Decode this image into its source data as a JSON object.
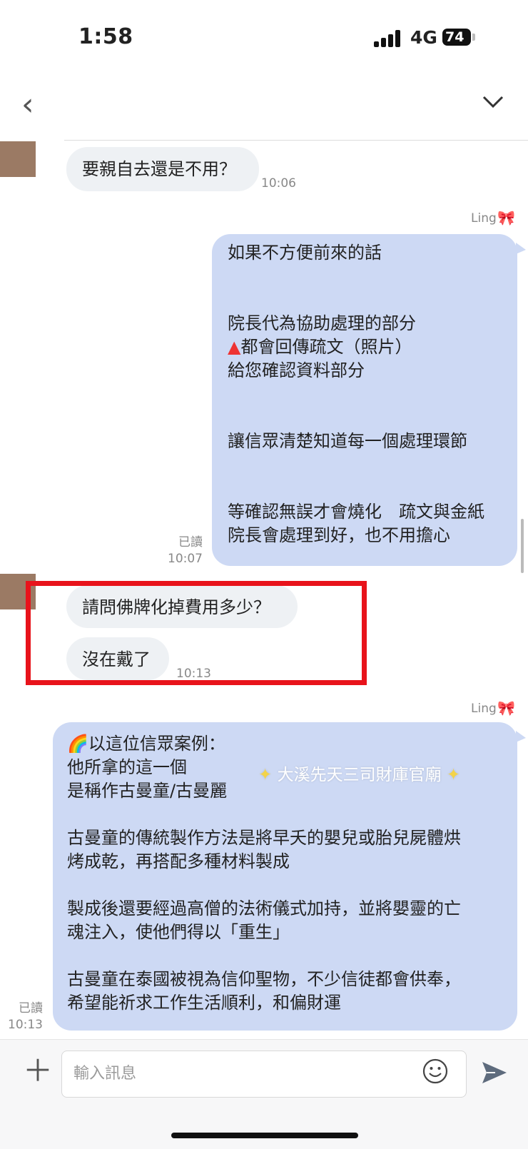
{
  "status_bar": {
    "time": "1:58",
    "network": "4G",
    "battery": "74"
  },
  "header": {
    "back_icon": "chevron-left-icon",
    "collapse_icon": "chevron-down-icon"
  },
  "messages": {
    "in1": {
      "text": "要親自去還是不用？",
      "time": "10:06"
    },
    "out1": {
      "sender": "Ling",
      "lines": [
        "如果不方便前來的話",
        "",
        "",
        "院長代為協助處理的部分",
        "▲都會回傳疏文（照片）",
        "給您確認資料部分",
        "",
        "",
        "讓信眾清楚知道每一個處理環節",
        "",
        "",
        "等確認無誤才會燒化　疏文與金紙",
        "院長會處理到好，也不用擔心"
      ],
      "read": "已讀",
      "time": "10:07"
    },
    "in2": {
      "text": "請問佛牌化掉費用多少？"
    },
    "in3": {
      "text": "沒在戴了",
      "time": "10:13"
    },
    "out2": {
      "sender": "Ling",
      "lines": [
        "🌈以這位信眾案例：",
        "他所拿的這一個",
        "是稱作古曼童/古曼麗",
        "",
        "古曼童的傳統製作方法是將早夭的嬰兒或胎兒屍體烘",
        "烤成乾，再搭配多種材料製成",
        "",
        "製成後還要經過高僧的法術儀式加持，並將嬰靈的亡",
        "魂注入，使他們得以「重生」",
        "",
        "古曼童在泰國被視為信仰聖物，不少信徒都會供奉，",
        "希望能祈求工作生活順利，和偏財運"
      ],
      "read": "已讀",
      "time": "10:13"
    }
  },
  "watermark": "大溪先天三司財庫官廟",
  "input": {
    "placeholder": "輸入訊息"
  },
  "icons": {
    "add": "plus-icon",
    "emoji": "smiley-icon",
    "send": "send-icon"
  },
  "colors": {
    "outgoing_bubble": "#cdd9f4",
    "incoming_bubble": "#eef1f4",
    "highlight": "#e8131b"
  }
}
